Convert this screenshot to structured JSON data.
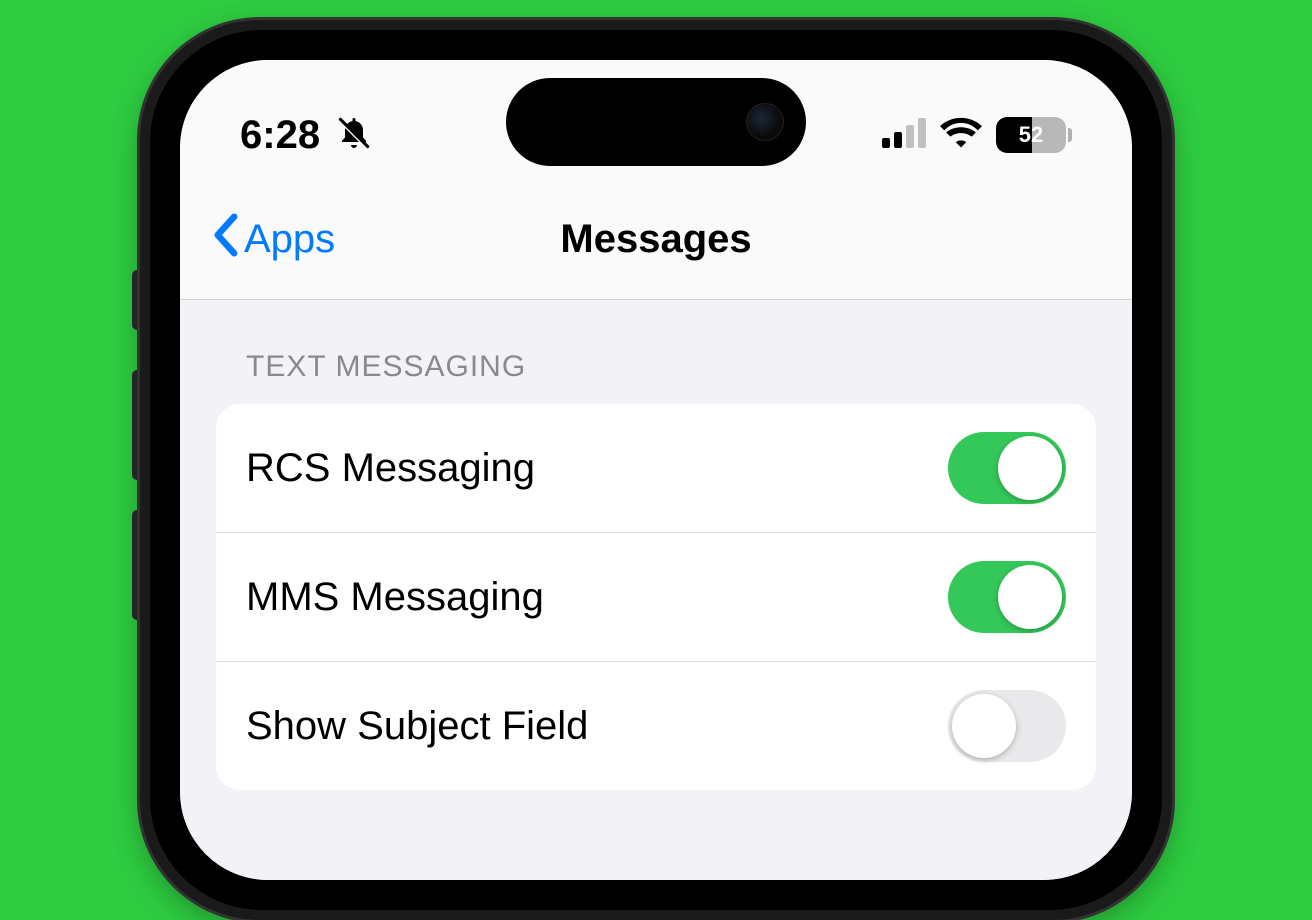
{
  "status": {
    "time": "6:28",
    "battery_percent": "52"
  },
  "nav": {
    "back_label": "Apps",
    "title": "Messages"
  },
  "section": {
    "header": "TEXT MESSAGING",
    "rows": [
      {
        "label": "RCS Messaging",
        "enabled": true
      },
      {
        "label": "MMS Messaging",
        "enabled": true
      },
      {
        "label": "Show Subject Field",
        "enabled": false
      }
    ]
  }
}
